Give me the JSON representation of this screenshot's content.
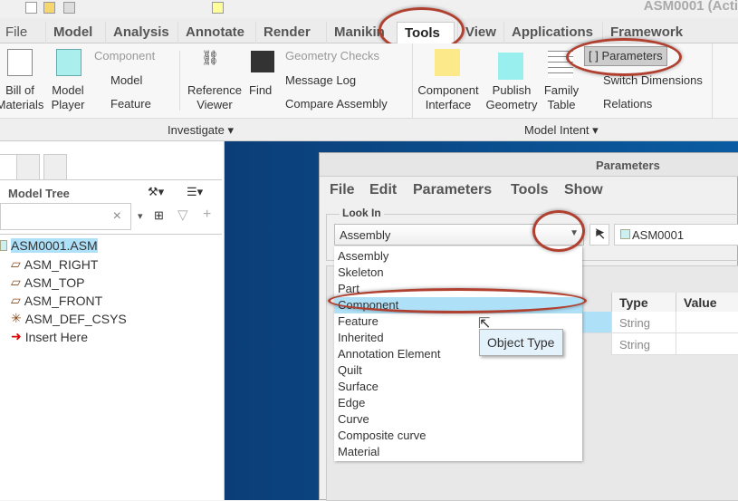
{
  "window": {
    "title": "ASM0001 (Acti"
  },
  "tabs": [
    "File",
    "Model",
    "Analysis",
    "Annotate",
    "Render",
    "Manikin",
    "Tools",
    "View",
    "Applications",
    "Framework"
  ],
  "active_tab": "Tools",
  "ribbon": {
    "bill_of_materials": "Bill of Materials",
    "model_player": "Model Player",
    "component": "Component",
    "model": "Model",
    "feature": "Feature",
    "reference_viewer": "Reference Viewer",
    "find": "Find",
    "geometry_checks": "Geometry Checks",
    "message_log": "Message Log",
    "compare_assembly": "Compare Assembly",
    "component_interface": "Component Interface",
    "publish_geometry": "Publish Geometry",
    "family_table": "Family Table",
    "parameters": "Parameters",
    "switch_dimensions": "Switch Dimensions",
    "relations": "Relations",
    "groups": {
      "investigate": "Investigate",
      "model_intent": "Model Intent"
    }
  },
  "model_tree": {
    "title": "Model Tree",
    "search_value": "",
    "items": [
      {
        "label": "ASM0001.ASM",
        "icon": "assembly-icon",
        "selected": true
      },
      {
        "label": "ASM_RIGHT",
        "icon": "datum-plane-icon"
      },
      {
        "label": "ASM_TOP",
        "icon": "datum-plane-icon"
      },
      {
        "label": "ASM_FRONT",
        "icon": "datum-plane-icon"
      },
      {
        "label": "ASM_DEF_CSYS",
        "icon": "csys-icon"
      },
      {
        "label": "Insert Here",
        "icon": "red-arrow-icon"
      }
    ]
  },
  "dialog": {
    "title": "Parameters",
    "menu": [
      "File",
      "Edit",
      "Parameters",
      "Tools",
      "Show"
    ],
    "look_in_label": "Look In",
    "look_in_value": "Assembly",
    "object_value": "ASM0001",
    "options": [
      "Assembly",
      "Skeleton",
      "Part",
      "Component",
      "Feature",
      "Inherited",
      "Annotation Element",
      "Quilt",
      "Surface",
      "Edge",
      "Curve",
      "Composite curve",
      "Material"
    ],
    "highlighted_option": "Component",
    "tooltip": "Object Type",
    "columns": {
      "type": "Type",
      "value": "Value"
    },
    "rows": [
      {
        "type": "String",
        "value": ""
      },
      {
        "type": "String",
        "value": ""
      }
    ]
  },
  "colors": {
    "accent_highlight": "#aee0f7",
    "annotation_oval": "#b04030",
    "background_blue": "#0a5ca2"
  }
}
